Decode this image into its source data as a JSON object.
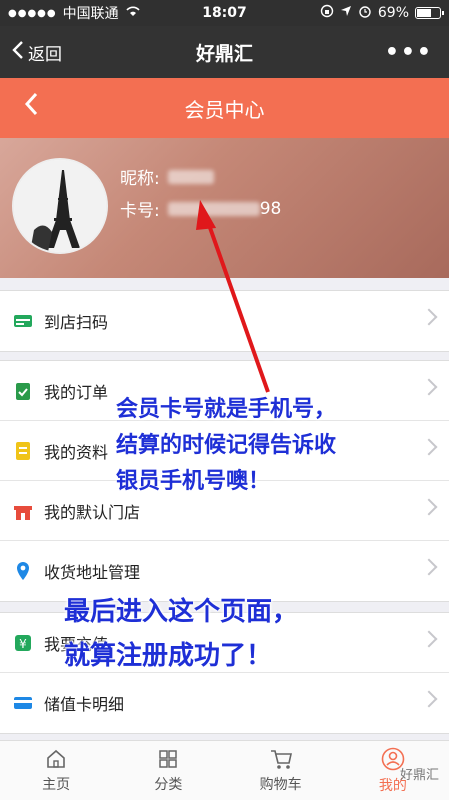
{
  "status_bar": {
    "carrier": "中国联通",
    "time": "18:07",
    "battery": "69%",
    "battery_level": 0.69
  },
  "nav": {
    "back_label": "返回",
    "title": "好鼎汇",
    "more": "•••"
  },
  "member_header": {
    "title": "会员中心",
    "back": "<"
  },
  "profile": {
    "nickname_label": "昵称:",
    "card_label": "卡号:",
    "card_suffix": "98"
  },
  "menu": [
    {
      "label": "到店扫码",
      "icon": "card-icon"
    },
    {
      "label": "我的订单",
      "icon": "order-icon"
    },
    {
      "label": "我的资料",
      "icon": "profile-doc-icon"
    },
    {
      "label": "我的默认门店",
      "icon": "store-icon"
    },
    {
      "label": "收货地址管理",
      "icon": "location-icon"
    },
    {
      "label": "我要充值",
      "icon": "recharge-icon"
    },
    {
      "label": "储值卡明细",
      "icon": "stored-card-icon"
    }
  ],
  "annotations": {
    "a1_line1": "会员卡号就是手机号，",
    "a1_line2": "结算的时候记得告诉收",
    "a1_line3": "银员手机号噢！",
    "a2_line1": "最后进入这个页面，",
    "a2_line2": "就算注册成功了！"
  },
  "tabbar": [
    {
      "label": "主页",
      "icon": "home-icon"
    },
    {
      "label": "分类",
      "icon": "category-icon"
    },
    {
      "label": "购物车",
      "icon": "cart-icon"
    },
    {
      "label": "我的",
      "icon": "user-icon"
    }
  ],
  "watermark": "好鼎汇",
  "colors": {
    "accent": "#f36f52",
    "annotation": "#1e2fd6",
    "arrow": "#e0181b"
  }
}
